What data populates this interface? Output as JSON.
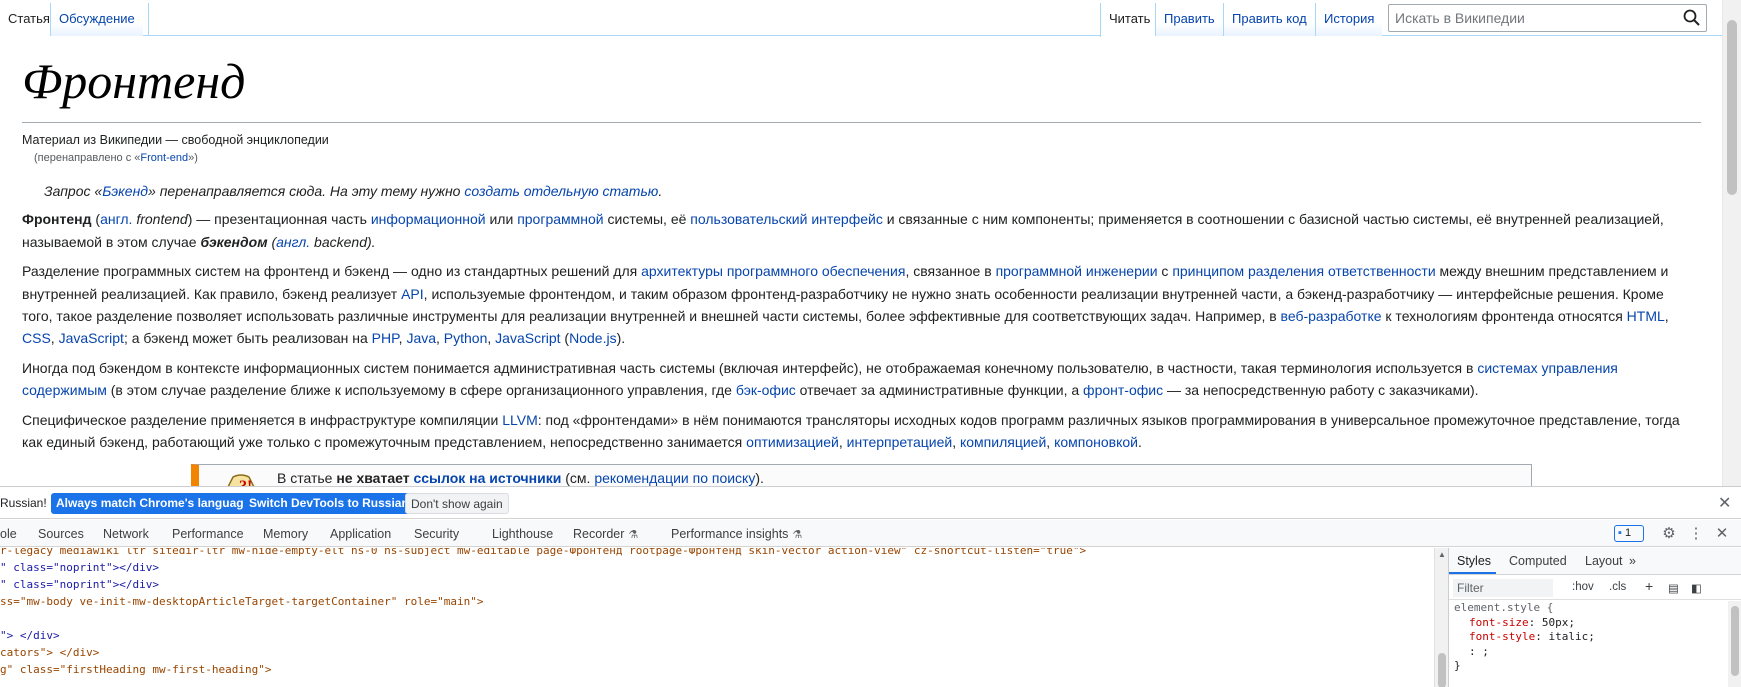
{
  "wiki": {
    "tabs_left": [
      "Статья",
      "Обсуждение"
    ],
    "tabs_right": [
      "Читать",
      "Править",
      "Править код",
      "История"
    ],
    "search_placeholder": "Искать в Википедии",
    "title": "Фронтенд",
    "site_sub": "Материал из Википедии — свободной энциклопедии",
    "redirect": {
      "prefix": "(перенаправлено с «",
      "link": "Front-end",
      "suffix": "»)"
    },
    "hatnote": {
      "t1": "Запрос «",
      "l1": "Бэкенд",
      "t2": "» перенаправляется сюда. На эту тему нужно ",
      "l2": "создать отдельную статью",
      "t3": "."
    },
    "p1": {
      "b1": "Фронтенд",
      "t1": " (",
      "l1": "англ.",
      "i1": " frontend",
      "t2": ") — презентационная часть ",
      "l2": "информационной",
      "t3": " или ",
      "l3": "программной",
      "t4": " системы, её ",
      "l4": "пользовательский интерфейс",
      "t5": " и связанные с ним компоненты; применяется в соотношении с базисной частью системы, её внутренней реализацией, называемой в этом случае ",
      "b2": "бэкендом",
      "t6": " (",
      "l5": "англ.",
      "i2": " backend",
      "t7": ")."
    },
    "p2": {
      "t1": "Разделение программных систем на фронтенд и бэкенд — одно из стандартных решений для ",
      "l1": "архитектуры программного обеспечения",
      "t2": ", связанное в ",
      "l2": "программной инженерии",
      "t3": " с ",
      "l3": "принципом разделения ответственности",
      "t4": " между внешним представлением и внутренней реализацией. Как правило, бэкенд реализует ",
      "l4": "API",
      "t5": ", используемые фронтендом, и таким образом фронтенд-разработчику не нужно знать особенности реализации внутренней части, а бэкенд-разработчику — интерфейсные решения. Кроме того, такое разделение позволяет использовать различные инструменты для реализации внутренней и внешней части системы, более эффективные для соответствующих задач. Например, в ",
      "l5": "веб-разработке",
      "t6": " к технологиям фронтенда относятся ",
      "l6": "HTML",
      "t7": ", ",
      "l7": "CSS",
      "t8": ", ",
      "l8": "JavaScript",
      "t9": "; а бэкенд может быть реализован на ",
      "l9": "PHP",
      "t10": ", ",
      "l10": "Java",
      "t11": ", ",
      "l11": "Python",
      "t12": ", ",
      "l12": "JavaScript",
      "t13": " (",
      "l13": "Node.js",
      "t14": ")."
    },
    "p3": {
      "t1": "Иногда под бэкендом в контексте информационных систем понимается административная часть системы (включая интерфейс), не отображаемая конечному пользователю, в частности, такая терминология используется в ",
      "l1": "системах управления содержимым",
      "t2": " (в этом случае разделение ближе к используемому в сфере организационного управления, где ",
      "l2": "бэк-офис",
      "t3": " отвечает за административные функции, а ",
      "l3": "фронт-офис",
      "t4": " — за непосредственную работу с заказчиками)."
    },
    "p4": {
      "t1": "Специфическое разделение применяется в инфраструктуре компиляции ",
      "l1": "LLVM",
      "t2": ": под «фронтендами» в нём понимаются трансляторы исходных кодов программ различных языков программирования в универсальное промежуточное представление, тогда как единый бэкенд, работающий уже только с промежуточным представлением, непосредственно занимается ",
      "l2": "оптимизацией",
      "t3": ", ",
      "l3": "интерпретацией",
      "t4": ", ",
      "l4": "компиляцией",
      "t5": ", ",
      "l5": "компоновкой",
      "t6": "."
    },
    "ambox": {
      "t1": "В статье ",
      "b1": "не хватает ",
      "l1": "ссылок на источники",
      "t2": " (см. ",
      "l2": "рекомендации по поиску",
      "t3": ")."
    },
    "colors": {
      "link": "#0645ad",
      "tab_border": "#a7d7f9",
      "ambox_accent": "#f28500"
    }
  },
  "devtools": {
    "infobar": {
      "message": "Russian!",
      "btn_match": "Always match Chrome's language",
      "btn_switch": "Switch DevTools to Russian",
      "btn_dismiss": "Don't show again"
    },
    "tabs": [
      "ole",
      "Sources",
      "Network",
      "Performance",
      "Memory",
      "Application",
      "Security",
      "Lighthouse",
      "Recorder",
      "Performance insights"
    ],
    "issues_count": "1",
    "elements": [
      {
        "t": "r-legacy mediawiki ltr sitedir-ltr mw-hide-empty-elt ns-0 ns-subject mw-editable page-Фронтенд rootpage-Фронтенд skin-vector action-view\" cz-shortcut-listen=\"true\">"
      },
      {
        "t": "\" class=\"noprint\"></div>"
      },
      {
        "t": "\" class=\"noprint\"></div>"
      },
      {
        "t": "ss=\"mw-body ve-init-mw-desktopArticleTarget-targetContainer\" role=\"main\">"
      },
      {
        "t": ""
      },
      {
        "t": "\"> </div>"
      },
      {
        "t": "cators\"> </div>"
      },
      {
        "t": "g\" class=\"firstHeading mw-first-heading\">"
      }
    ],
    "styles_tabs": [
      "Styles",
      "Computed",
      "Layout"
    ],
    "filter_placeholder": "Filter",
    "hov": ":hov",
    "cls": ".cls",
    "rule": {
      "selector": "element.style {",
      "p1_name": "font-size",
      "p1_value": "50px;",
      "p2_name": "font-style",
      "p2_value": "italic;",
      "p3": ": ;",
      "close": "}"
    },
    "colors": {
      "accent": "#1a73e8",
      "tag": "#881280",
      "attr_name": "#994500",
      "attr_value": "#1a1aa6",
      "css_prop": "#c80000"
    }
  }
}
